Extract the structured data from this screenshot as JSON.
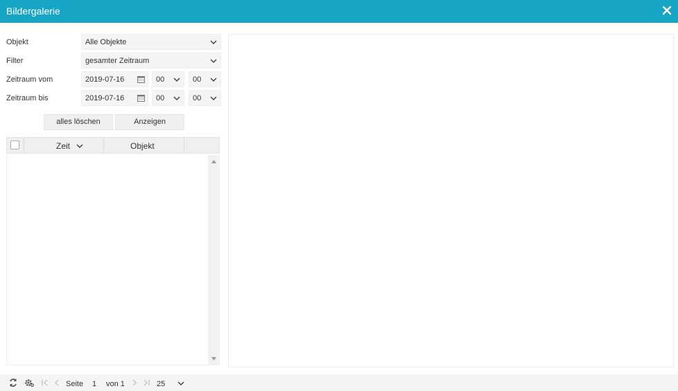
{
  "window": {
    "title": "Bildergalerie"
  },
  "form": {
    "object_label": "Objekt",
    "object_value": "Alle Objekte",
    "filter_label": "Filter",
    "filter_value": "gesamter Zeitraum",
    "from_label": "Zeitraum vom",
    "from_date": "2019-07-16",
    "from_hour": "00",
    "from_minute": "00",
    "to_label": "Zeitraum bis",
    "to_date": "2019-07-16",
    "to_hour": "00",
    "to_minute": "00",
    "clear_label": "alles löschen",
    "show_label": "Anzeigen"
  },
  "grid": {
    "columns": [
      "Zeit",
      "Objekt"
    ]
  },
  "pager": {
    "page_label": "Seite",
    "page_value": "1",
    "of_label": "von 1",
    "page_size": "25"
  },
  "colors": {
    "accent": "#17a5c5",
    "icon": "#555555"
  }
}
